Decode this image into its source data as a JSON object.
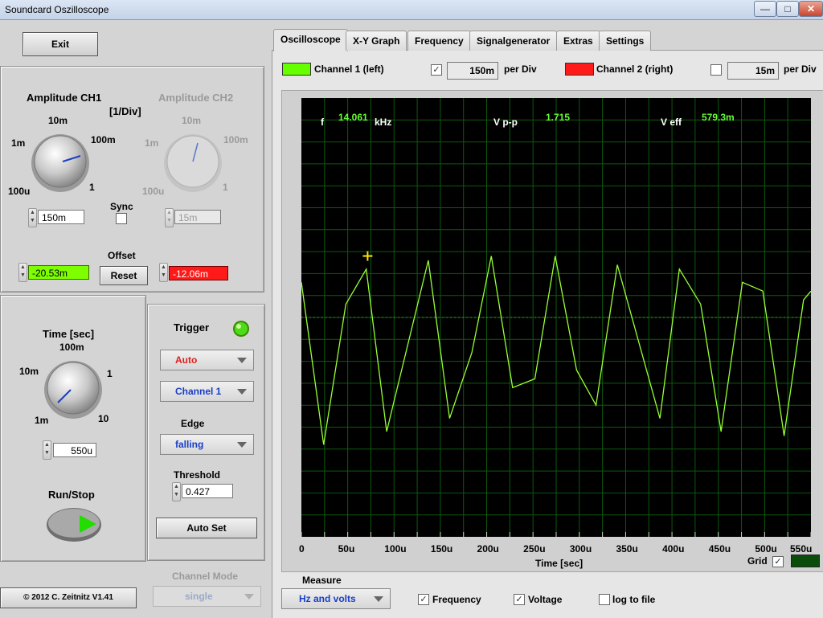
{
  "window": {
    "title": "Soundcard Oszilloscope"
  },
  "controls": {
    "exit_label": "Exit",
    "amp_ch1_title": "Amplitude CH1",
    "amp_ch1_unit": "[1/Div]",
    "amp_ch2_title": "Amplitude CH2",
    "knob_ticks": {
      "t10m": "10m",
      "t1m": "1m",
      "t100m": "100m",
      "t100u": "100u",
      "t1": "1"
    },
    "ch1_amp_value": "150m",
    "ch2_amp_value": "15m",
    "sync_label": "Sync",
    "offset_label": "Offset",
    "ch1_offset": "-20.53m",
    "ch2_offset": "-12.06m",
    "reset_label": "Reset",
    "time_title": "Time [sec]",
    "time_ticks": {
      "t100m": "100m",
      "t10m": "10m",
      "t1": "1",
      "t1m": "1m",
      "t10": "10"
    },
    "time_value": "550u",
    "runstop_label": "Run/Stop",
    "copyright": "© 2012  C. Zeitnitz V1.41",
    "channel_mode_label": "Channel Mode",
    "channel_mode_value": "single"
  },
  "trigger": {
    "title": "Trigger",
    "mode": "Auto",
    "channel": "Channel 1",
    "edge_label": "Edge",
    "edge": "falling",
    "threshold_label": "Threshold",
    "threshold": "0.427",
    "autoset_label": "Auto Set"
  },
  "tabs": [
    {
      "label": "Oscilloscope"
    },
    {
      "label": "X-Y Graph"
    },
    {
      "label": "Frequency"
    },
    {
      "label": "Signalgenerator"
    },
    {
      "label": "Extras"
    },
    {
      "label": "Settings"
    }
  ],
  "channels": {
    "ch1_label": "Channel 1 (left)",
    "ch1_color": "#66ff00",
    "ch1_checked": "✓",
    "ch1_div": "150m",
    "per_div": "per Div",
    "ch2_label": "Channel 2 (right)",
    "ch2_color": "#ff1a1a",
    "ch2_div": "15m"
  },
  "readouts": {
    "f_label": "f",
    "f_value": "14.061",
    "f_unit": "kHz",
    "vpp_label": "V p-p",
    "vpp_value": "1.715",
    "veff_label": "V eff",
    "veff_value": "579.3m"
  },
  "chart_data": {
    "type": "line",
    "xlabel": "Time [sec]",
    "x_ticks": [
      "0",
      "50u",
      "100u",
      "150u",
      "200u",
      "250u",
      "300u",
      "350u",
      "400u",
      "450u",
      "500u",
      "550u"
    ],
    "xlim": [
      0,
      550
    ],
    "ylim": [
      -5,
      5
    ],
    "grid": true,
    "series": [
      {
        "color": "#99ff33",
        "points": [
          [
            0,
            0.8
          ],
          [
            24,
            -2.9
          ],
          [
            48,
            0.3
          ],
          [
            70,
            1.1
          ],
          [
            92,
            -2.6
          ],
          [
            137,
            1.3
          ],
          [
            160,
            -2.3
          ],
          [
            184,
            -0.8
          ],
          [
            205,
            1.4
          ],
          [
            228,
            -1.6
          ],
          [
            252,
            -1.4
          ],
          [
            274,
            1.4
          ],
          [
            297,
            -1.2
          ],
          [
            318,
            -2.0
          ],
          [
            341,
            1.2
          ],
          [
            387,
            -2.3
          ],
          [
            408,
            1.1
          ],
          [
            431,
            0.3
          ],
          [
            453,
            -2.6
          ],
          [
            476,
            0.8
          ],
          [
            498,
            0.6
          ],
          [
            521,
            -2.7
          ],
          [
            542,
            0.4
          ],
          [
            550,
            0.6
          ]
        ]
      }
    ]
  },
  "grid": {
    "label": "Grid",
    "checked": "✓"
  },
  "measure": {
    "title": "Measure",
    "mode": "Hz and volts",
    "frequency_label": "Frequency",
    "frequency_checked": "✓",
    "voltage_label": "Voltage",
    "voltage_checked": "✓",
    "logfile_label": "log to file"
  }
}
